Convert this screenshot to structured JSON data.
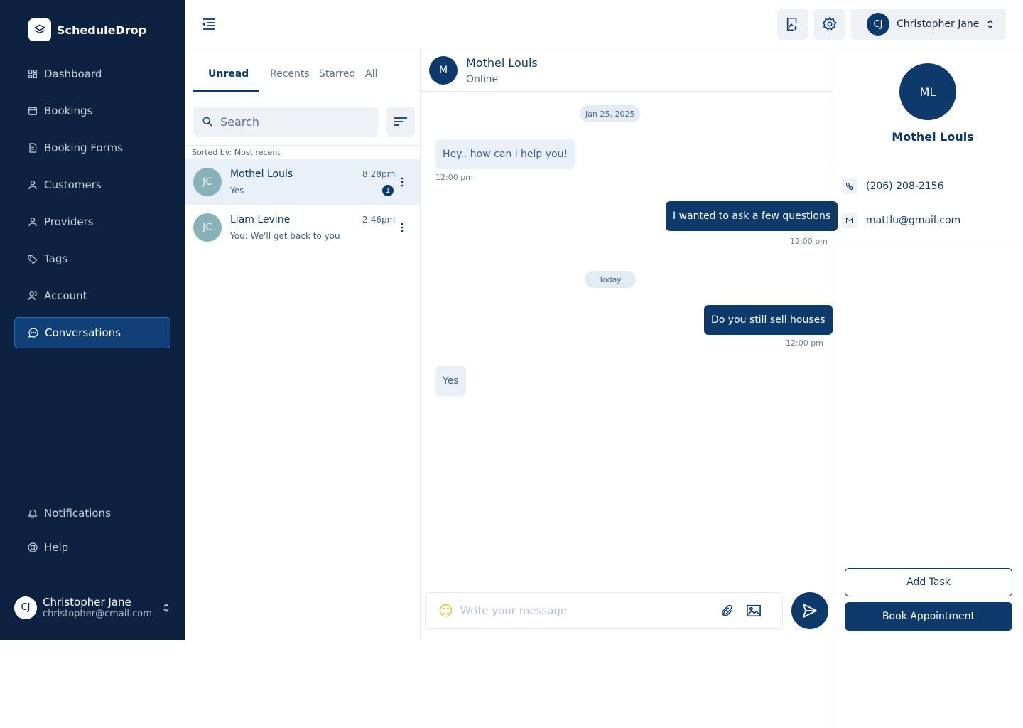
{
  "brand": {
    "name": "ScheduleDrop"
  },
  "sidebar": {
    "items": [
      {
        "label": "Dashboard",
        "icon": "grid-icon"
      },
      {
        "label": "Bookings",
        "icon": "calendar-icon"
      },
      {
        "label": "Booking Forms",
        "icon": "document-icon"
      },
      {
        "label": "Customers",
        "icon": "user-icon"
      },
      {
        "label": "Providers",
        "icon": "user-icon"
      },
      {
        "label": "Tags",
        "icon": "tag-icon"
      },
      {
        "label": "Account",
        "icon": "users-icon"
      },
      {
        "label": "Conversations",
        "icon": "chat-icon",
        "active": true
      }
    ],
    "bottom_items": [
      {
        "label": "Notifications",
        "icon": "bell-icon"
      },
      {
        "label": "Help",
        "icon": "lifebuoy-icon"
      }
    ],
    "user": {
      "initials": "CJ",
      "name": "Christopher Jane",
      "email": "christopher@cmail.com"
    }
  },
  "header": {
    "user": {
      "initials": "CJ",
      "name": "Christopher Jane"
    }
  },
  "list": {
    "tabs": [
      "Unread",
      "Recents",
      "Starred",
      "All"
    ],
    "active_tab": "Unread",
    "search_placeholder": "Search",
    "sorted_by": "Sorted by: Most recent",
    "conversations": [
      {
        "initials": "JC",
        "name": "Mothel Louis",
        "preview": "Yes",
        "time": "8:28pm",
        "unread": "1",
        "selected": true
      },
      {
        "initials": "JC",
        "name": "Liam Levine",
        "preview": "You: We'll get back to you",
        "time": "2:46pm"
      }
    ]
  },
  "chat": {
    "contact": {
      "initial": "M",
      "name": "Mothel Louis",
      "status": "Online"
    },
    "dates": [
      "Jan 25, 2025",
      "Today"
    ],
    "messages": [
      {
        "direction": "in",
        "text": "Hey.. how can i help you!",
        "time": "12:00 pm"
      },
      {
        "direction": "out",
        "text": "I wanted to ask a few questions",
        "time": "12:00 pm"
      },
      {
        "direction": "out",
        "text": "Do you still sell houses",
        "time": "12:00 pm"
      },
      {
        "direction": "in",
        "text": "Yes"
      }
    ],
    "composer_placeholder": "Write your message"
  },
  "profile": {
    "initials": "ML",
    "name": "Mothel Louis",
    "phone": "(206) 208-2156",
    "email": "mattlu@gmail.com",
    "add_task_label": "Add Task",
    "book_label": "Book Appointment"
  },
  "colors": {
    "primary": "#0e3a6b",
    "sidebar": "#0c2240",
    "muted_bg": "#eef2f7"
  }
}
